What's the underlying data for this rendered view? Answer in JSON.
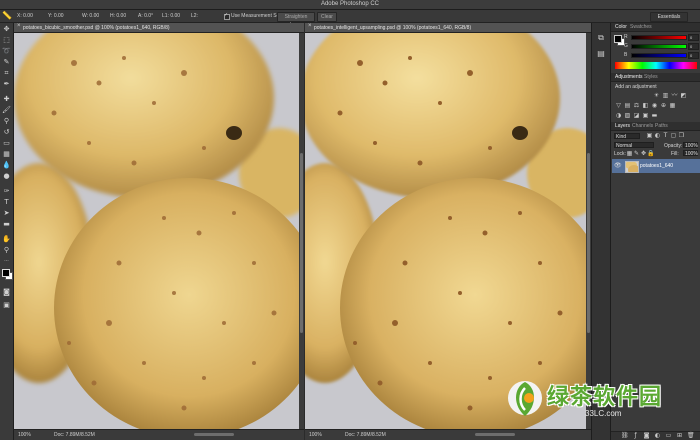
{
  "app": {
    "title": "Adobe Photoshop CC"
  },
  "options": {
    "x_label": "X: 0.00",
    "y_label": "Y: 0.00",
    "w_label": "W: 0.00",
    "h_label": "H: 0.00",
    "a_label": "A: 0.0°",
    "l1_label": "L1: 0.00",
    "l2_label": "L2:",
    "measure_label": "Use Measurement Scale",
    "straighten_label": "Straighten Layer",
    "clear_label": "Clear",
    "workspace_label": "Essentials"
  },
  "documents": [
    {
      "tab_label": "potatoes_bicubic_smoother.psd @ 100% (potatoes1_640, RGB/8)",
      "zoom": "100%",
      "doc_info": "Doc: 7.89M/8.52M"
    },
    {
      "tab_label": "potatoes_intelligent_upsampling.psd @ 100% (potatoes1_640, RGB/8)",
      "zoom": "100%",
      "doc_info": "Doc: 7.89M/8.52M"
    }
  ],
  "color_panel": {
    "tabs": [
      "Color",
      "Swatches"
    ],
    "channels": [
      {
        "label": "R",
        "value": "0"
      },
      {
        "label": "G",
        "value": "0"
      },
      {
        "label": "B",
        "value": "0"
      }
    ]
  },
  "adjustments_panel": {
    "tabs": [
      "Adjustments",
      "Styles"
    ],
    "heading": "Add an adjustment"
  },
  "layers_panel": {
    "tabs": [
      "Layers",
      "Channels",
      "Paths"
    ],
    "kind_label": "Kind",
    "blend_mode": "Normal",
    "opacity_label": "Opacity:",
    "opacity_value": "100%",
    "lock_label": "Lock:",
    "fill_label": "Fill:",
    "fill_value": "100%",
    "layers": [
      {
        "name": "potatoes1_640"
      }
    ]
  },
  "colors": {
    "ui_dark": "#2b2b2b",
    "panel": "#3a3a3a",
    "selection": "#56719a",
    "potato": "#d8b46a",
    "watermark_green": "#5aa832"
  },
  "watermark": {
    "text": "绿茶软件园",
    "url": "33LC.com"
  }
}
